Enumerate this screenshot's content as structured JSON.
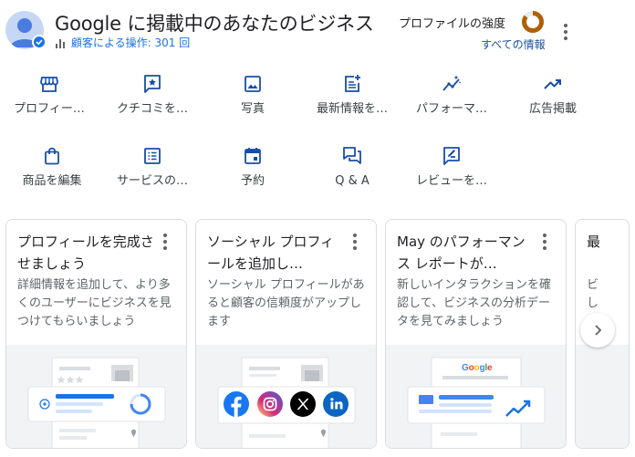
{
  "header": {
    "title": "Google に掲載中のあなたのビジネス",
    "interactions": "顧客による操作: 301 回",
    "strength_label": "プロファイルの強度",
    "all_info_link": "すべての情報"
  },
  "actions": [
    {
      "label": "プロフィー…",
      "icon": "storefront-icon"
    },
    {
      "label": "クチコミを…",
      "icon": "review-star-icon"
    },
    {
      "label": "写真",
      "icon": "photo-icon"
    },
    {
      "label": "最新情報を…",
      "icon": "post-add-icon"
    },
    {
      "label": "パフォーマ…",
      "icon": "performance-icon"
    },
    {
      "label": "広告掲載",
      "icon": "trending-up-icon"
    },
    {
      "label": "商品を編集",
      "icon": "shopping-bag-icon"
    },
    {
      "label": "サービスの…",
      "icon": "list-icon"
    },
    {
      "label": "予約",
      "icon": "calendar-icon"
    },
    {
      "label": "Q & A",
      "icon": "forum-icon"
    },
    {
      "label": "レビューを…",
      "icon": "rate-review-icon"
    }
  ],
  "cards": [
    {
      "title": "プロフィールを完成させましょう",
      "desc": "詳細情報を追加して、より多くのユーザーにビジネスを見つけてもらいましょう"
    },
    {
      "title": "ソーシャル プロフィールを追加し…",
      "desc": "ソーシャル プロフィールがあると顧客の信頼度がアップします"
    },
    {
      "title": "May のパフォーマンス レポートが…",
      "desc": "新しいインタラクションを確認して、ビジネスの分析データを見てみましょう",
      "illustration_text": "Google"
    },
    {
      "title": "最",
      "desc": "ビし"
    }
  ],
  "colors": {
    "accent": "#1a73e8",
    "icon_blue": "#174ea6",
    "strength_ring": "#b06000"
  },
  "profile_strength": 0.85
}
